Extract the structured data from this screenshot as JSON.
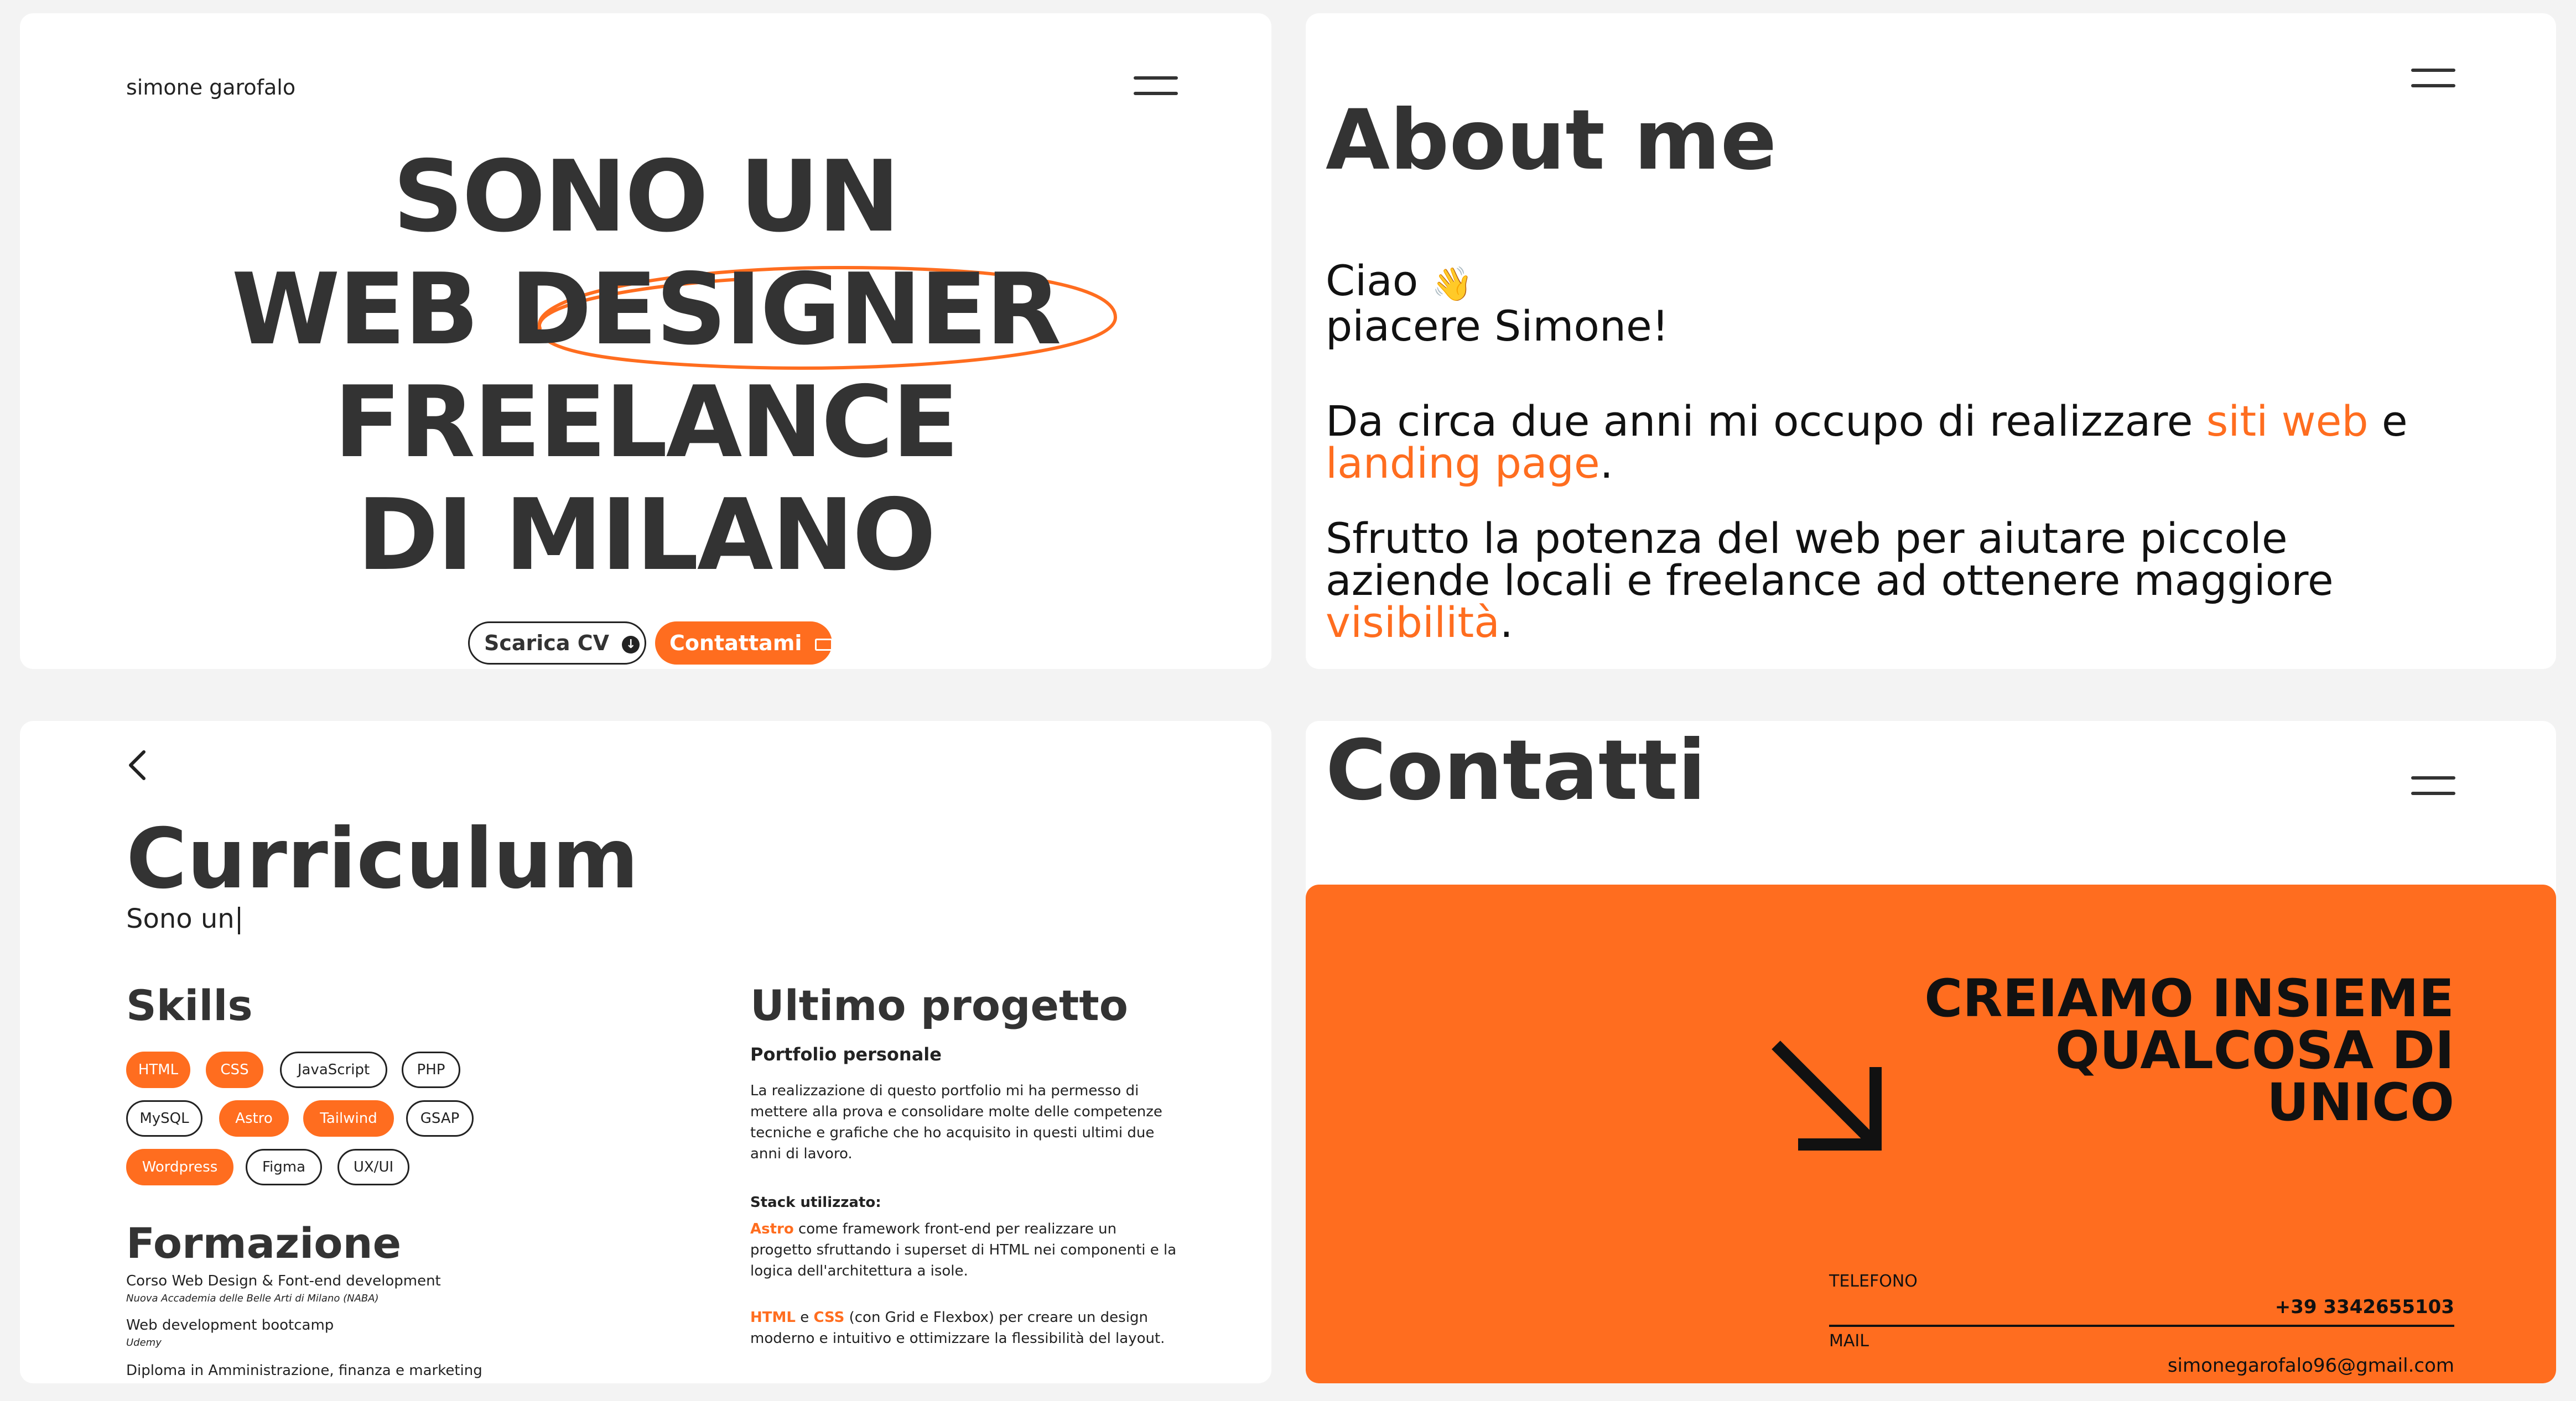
{
  "hero_panel": {
    "brand": "simone garofalo",
    "headline": [
      "SONO UN",
      "WEB DESIGNER",
      "FREELANCE",
      "DI MILANO"
    ],
    "cv_button": "Scarica CV",
    "contact_button": "Contattami"
  },
  "about_panel": {
    "title": "About me",
    "greeting_line1": "Ciao",
    "greeting_line2": "piacere Simone!",
    "p1_text1": "Da circa due anni mi occupo di realizzare ",
    "p1_link1": "siti web",
    "p1_text2": " e",
    "p1_link2": "landing page",
    "p1_text3": ".",
    "p2_line1": "Sfrutto la potenza del web per aiutare piccole",
    "p2_line2": "aziende locali e freelance ad ottenere maggiore",
    "p2_link": "visibilità",
    "p2_end": "."
  },
  "curriculum_panel": {
    "title": "Curriculum",
    "typed_text": "Sono un",
    "skills_title": "Skills",
    "skills": [
      {
        "label": "HTML",
        "highlight": true
      },
      {
        "label": "CSS",
        "highlight": true
      },
      {
        "label": "JavaScript",
        "highlight": false
      },
      {
        "label": "PHP",
        "highlight": false
      },
      {
        "label": "MySQL",
        "highlight": false
      },
      {
        "label": "Astro",
        "highlight": true
      },
      {
        "label": "Tailwind",
        "highlight": true
      },
      {
        "label": "GSAP",
        "highlight": false
      },
      {
        "label": "Wordpress",
        "highlight": true
      },
      {
        "label": "Figma",
        "highlight": false
      },
      {
        "label": "UX/UI",
        "highlight": false
      }
    ],
    "formazione_title": "Formazione",
    "formazione": [
      {
        "course": "Corso Web Design & Font-end development",
        "school": "Nuova Accademia delle Belle Arti di Milano (NABA)"
      },
      {
        "course": "Web development bootcamp",
        "school": "Udemy"
      },
      {
        "course": "Diploma in Amministrazione, finanza e marketing",
        "school": ""
      }
    ],
    "project_title": "Ultimo progetto",
    "project_subtitle": "Portfolio personale",
    "project_desc": [
      "La realizzazione di questo portfolio mi ha permesso di",
      "mettere alla prova e consolidare molte delle competenze",
      "tecniche e grafiche che ho acquisito in questi ultimi due",
      "anni di lavoro."
    ],
    "stack_title": "Stack utilizzato:",
    "stack_astro_name": "Astro",
    "stack_astro_l1": " come framework front-end per realizzare un",
    "stack_astro_l2": "progetto sfruttando i superset di HTML nei componenti e la",
    "stack_astro_l3": "logica dell'architettura a isole.",
    "stack_html": "HTML",
    "stack_and": " e ",
    "stack_css": "CSS",
    "stack_css_l1": " (con Grid e Flexbox) per creare un design",
    "stack_css_l2": "moderno e intuitivo e ottimizzare la flessibilità del layout."
  },
  "contact_panel": {
    "title": "Contatti",
    "cta": [
      "CREIAMO INSIEME",
      "QUALCOSA DI",
      "UNICO"
    ],
    "phone_label": "TELEFONO",
    "phone_value": "+39 3342655103",
    "mail_label": "MAIL",
    "mail_value": "simonegarofalo96@gmail.com"
  },
  "colors": {
    "accent": "#ff6d1f",
    "text": "#333333",
    "background": "#f3f3f3"
  },
  "icons": [
    "menu-icon",
    "download-icon",
    "mail-icon",
    "waving-hand-icon",
    "chevron-left-icon",
    "arrow-down-right-icon"
  ]
}
